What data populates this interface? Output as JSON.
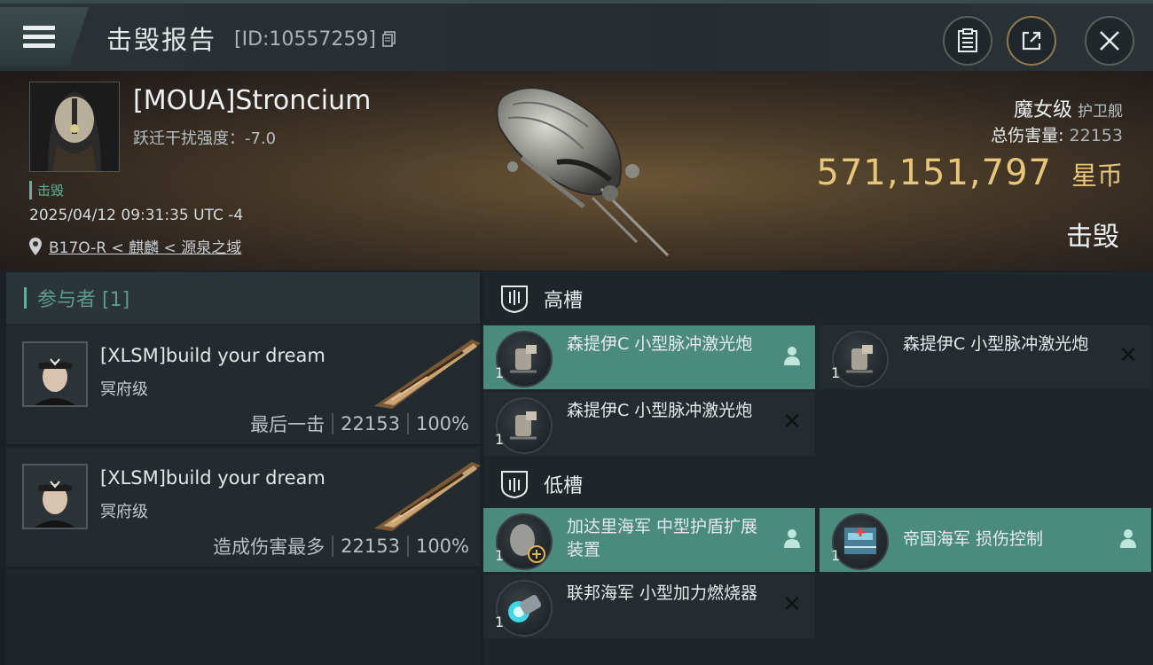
{
  "header": {
    "title": "击毁报告",
    "report_id": "[ID:10557259]"
  },
  "victim": {
    "name": "[MOUA]Stroncium",
    "warp_disruption": "跃迁干扰强度：-7.0",
    "status": "击毁",
    "datetime": "2025/04/12 09:31:35 UTC -4",
    "location": "B17O-R < 麒麟 < 源泉之域",
    "ship_class": "魔女级",
    "ship_type": "护卫舰",
    "damage_label": "总伤害量:",
    "damage_value": "22153",
    "isk_value": "571,151,797",
    "isk_unit": "星币",
    "result": "击毁"
  },
  "participants": {
    "header": "参与者 [1]",
    "rows": [
      {
        "name": "[XLSM]build your dream",
        "ship": "冥府级",
        "label": "最后一击",
        "damage": "22153",
        "percent": "100%"
      },
      {
        "name": "[XLSM]build your dream",
        "ship": "冥府级",
        "label": "造成伤害最多",
        "damage": "22153",
        "percent": "100%"
      }
    ]
  },
  "fitting": {
    "high_label": "高槽",
    "low_label": "低槽",
    "high_modules": [
      {
        "name": "森提伊C 小型脉冲激光炮",
        "qty": "1",
        "state": "fitted"
      },
      {
        "name": "森提伊C 小型脉冲激光炮",
        "qty": "1",
        "state": "destroyed"
      },
      {
        "name": "森提伊C 小型脉冲激光炮",
        "qty": "1",
        "state": "destroyed"
      }
    ],
    "low_modules": [
      {
        "name": "加达里海军 中型护盾扩展装置",
        "qty": "1",
        "state": "fitted"
      },
      {
        "name": "帝国海军 损伤控制",
        "qty": "1",
        "state": "fitted"
      },
      {
        "name": "联邦海军 小型加力燃烧器",
        "qty": "1",
        "state": "destroyed"
      }
    ]
  },
  "colors": {
    "accent": "#5fb39b",
    "isk": "#e7c67a",
    "active_row": "#4b8b7d"
  }
}
